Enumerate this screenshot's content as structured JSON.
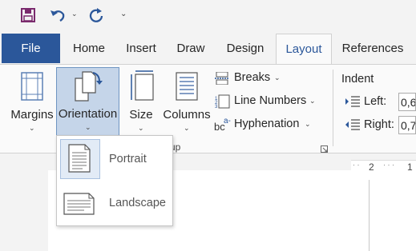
{
  "qat": {
    "save_icon": "save-icon",
    "undo_icon": "undo-icon",
    "redo_icon": "redo-icon"
  },
  "tabs": {
    "file": "File",
    "home": "Home",
    "insert": "Insert",
    "draw": "Draw",
    "design": "Design",
    "layout": "Layout",
    "references": "References"
  },
  "page_setup": {
    "margins": "Margins",
    "orientation": "Orientation",
    "size": "Size",
    "columns": "Columns",
    "breaks": "Breaks",
    "line_numbers": "Line Numbers",
    "hyphenation": "Hyphenation",
    "group_label_fragment": "up"
  },
  "indent": {
    "title": "Indent",
    "left_label": "Left:",
    "right_label": "Right:",
    "left_value": "0,6",
    "right_value": "0,7"
  },
  "ruler": {
    "mark_2": "2",
    "mark_1": "1"
  },
  "orientation_menu": {
    "portrait": "Portrait",
    "landscape": "Landscape"
  },
  "colors": {
    "accent": "#2b579a",
    "selected_bg": "#c5d5e9",
    "selected_border": "#6f95c2"
  }
}
